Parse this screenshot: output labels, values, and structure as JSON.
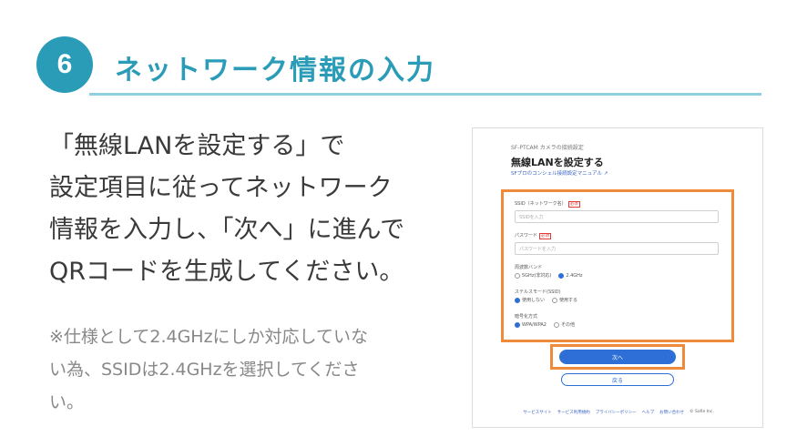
{
  "step": {
    "number": "6",
    "title": "ネットワーク情報の入力"
  },
  "instructions": [
    "「無線LANを設定する」で",
    "設定項目に従ってネットワーク",
    "情報を入力し、「次へ」に進んで",
    "QRコードを生成してください。"
  ],
  "note": [
    "※仕様として2.4GHzにしか対応していな",
    "い為、SSIDは2.4GHzを選択してくださ",
    "い。"
  ],
  "screen": {
    "breadcrumb": "SF-PTCAM カメラの接続設定",
    "title": "無線LANを設定する",
    "help_link": "SFプロのコンシェル接続設定マニュアル ↗",
    "fields": [
      {
        "label": "SSID（ネットワーク名）",
        "required": "必須",
        "placeholder": "SSIDを入力"
      },
      {
        "label": "パスワード",
        "required": "必須",
        "placeholder": "パスワードを入力"
      }
    ],
    "radio_groups": [
      {
        "label": "周波数バンド",
        "options": [
          "5GHz(非対応)",
          "2.4GHz"
        ],
        "selected": 1
      },
      {
        "label": "ステルスモード(SSID)",
        "options": [
          "使用しない",
          "使用する"
        ],
        "selected": 0
      },
      {
        "label": "暗号化方式",
        "options": [
          "WPA/WPA2",
          "その他"
        ],
        "selected": 0
      }
    ],
    "next_label": "次へ",
    "back_label": "戻る",
    "footer_links": [
      "サービスサイト",
      "サービス利用規約",
      "プライバシーポリシー",
      "ヘルプ",
      "お問い合わせ"
    ],
    "copyright": "© Safie Inc."
  },
  "colors": {
    "accent": "#2a9cb8",
    "highlight": "#ee8a3a",
    "button": "#2d6fd6"
  }
}
